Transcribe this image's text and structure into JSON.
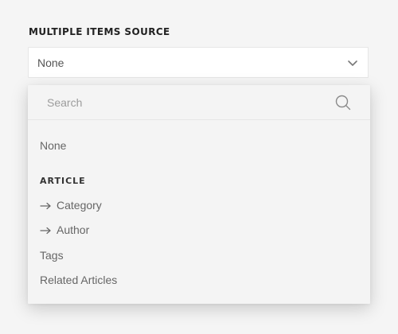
{
  "field": {
    "label": "MULTIPLE ITEMS SOURCE",
    "selected_value": "None",
    "chevron_icon": "chevron-down-icon"
  },
  "dropdown": {
    "search": {
      "placeholder": "Search",
      "icon": "search-icon"
    },
    "options": [
      {
        "label": "None"
      }
    ],
    "groups": [
      {
        "heading": "ARTICLE",
        "items": [
          {
            "label": "Category",
            "icon": "arrow-right-icon"
          },
          {
            "label": "Author",
            "icon": "arrow-right-icon"
          },
          {
            "label": "Tags"
          },
          {
            "label": "Related Articles"
          }
        ]
      }
    ]
  }
}
